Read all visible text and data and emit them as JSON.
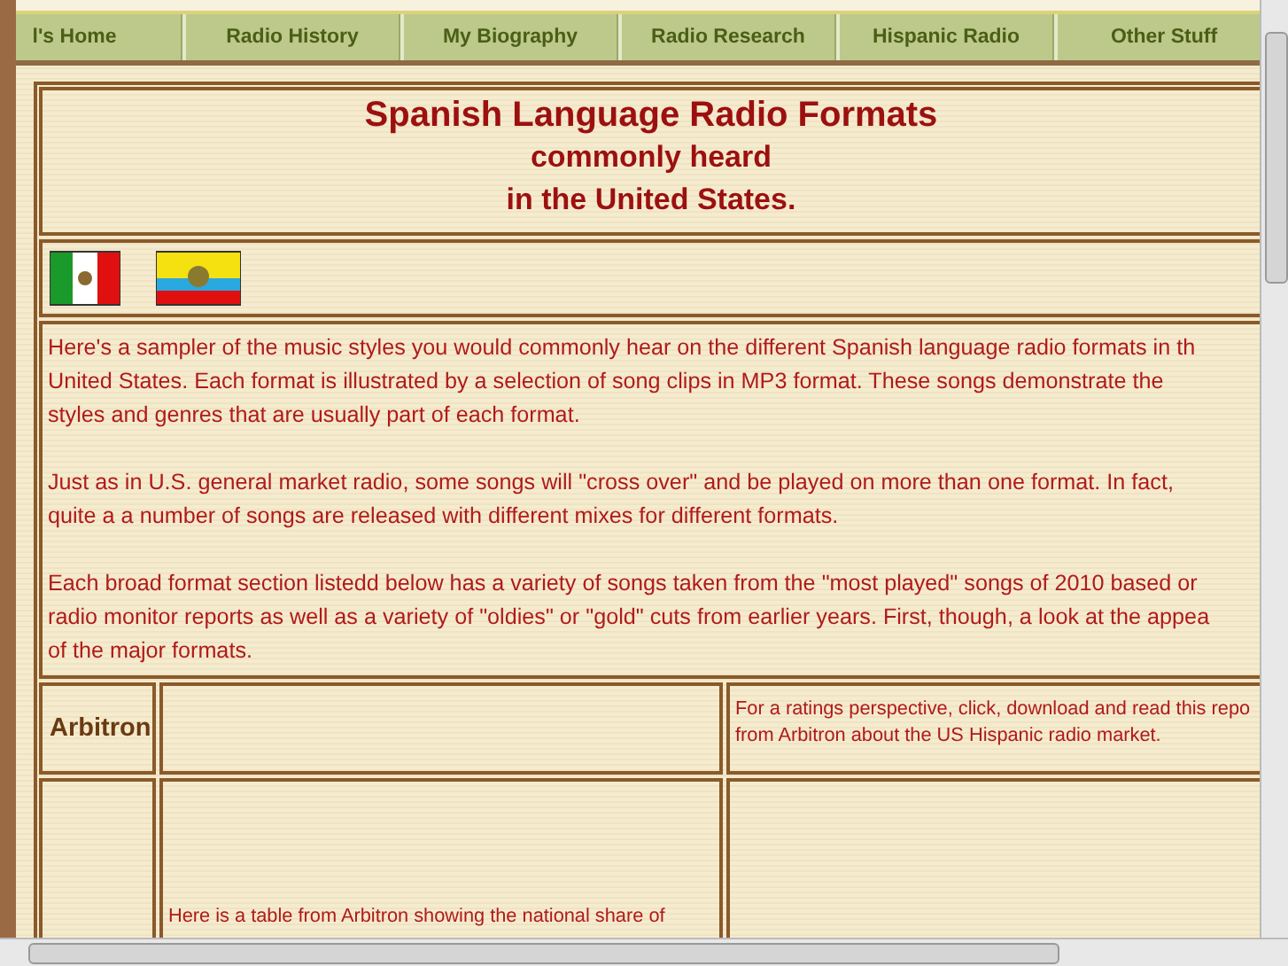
{
  "nav": [
    {
      "label": "l's Home"
    },
    {
      "label": "Radio History"
    },
    {
      "label": "My Biography"
    },
    {
      "label": "Radio Research"
    },
    {
      "label": "Hispanic Radio"
    },
    {
      "label": "Other Stuff"
    }
  ],
  "title": {
    "heading": "Spanish Language Radio Formats",
    "subtitle": [
      "commonly heard",
      "in the United States."
    ]
  },
  "flags": [
    {
      "kind": "mexico"
    },
    {
      "kind": "ecuador"
    }
  ],
  "intro": [
    [
      "Here's a sampler of the music styles you would commonly hear on the different Spanish language radio formats in th",
      "United States. Each format is illustrated by a selection of song clips in MP3 format. These songs demonstrate the",
      "styles and genres that are usually part of each format."
    ],
    [
      "Just as in U.S. general market radio, some songs will \"cross over\" and be played on more than one format. In fact,",
      "quite a a number of songs are released with different mixes for different formats."
    ],
    [
      "Each broad format section listedd below has a variety of songs taken from the \"most played\" songs of 2010 based or",
      "radio monitor reports as well as a variety of \"oldies\" or \"gold\" cuts from earlier years. First, though, a look at the appea",
      "of the major formats."
    ]
  ],
  "table": {
    "rows": [
      {
        "label": "Arbitron",
        "middle": [],
        "right": [
          "For a ratings perspective, click, download and read this repo",
          "from Arbitron about the US Hispanic radio market."
        ]
      },
      {
        "label": "",
        "middle": [
          "Here is a table from Arbitron showing the national share of"
        ],
        "right": []
      }
    ]
  }
}
